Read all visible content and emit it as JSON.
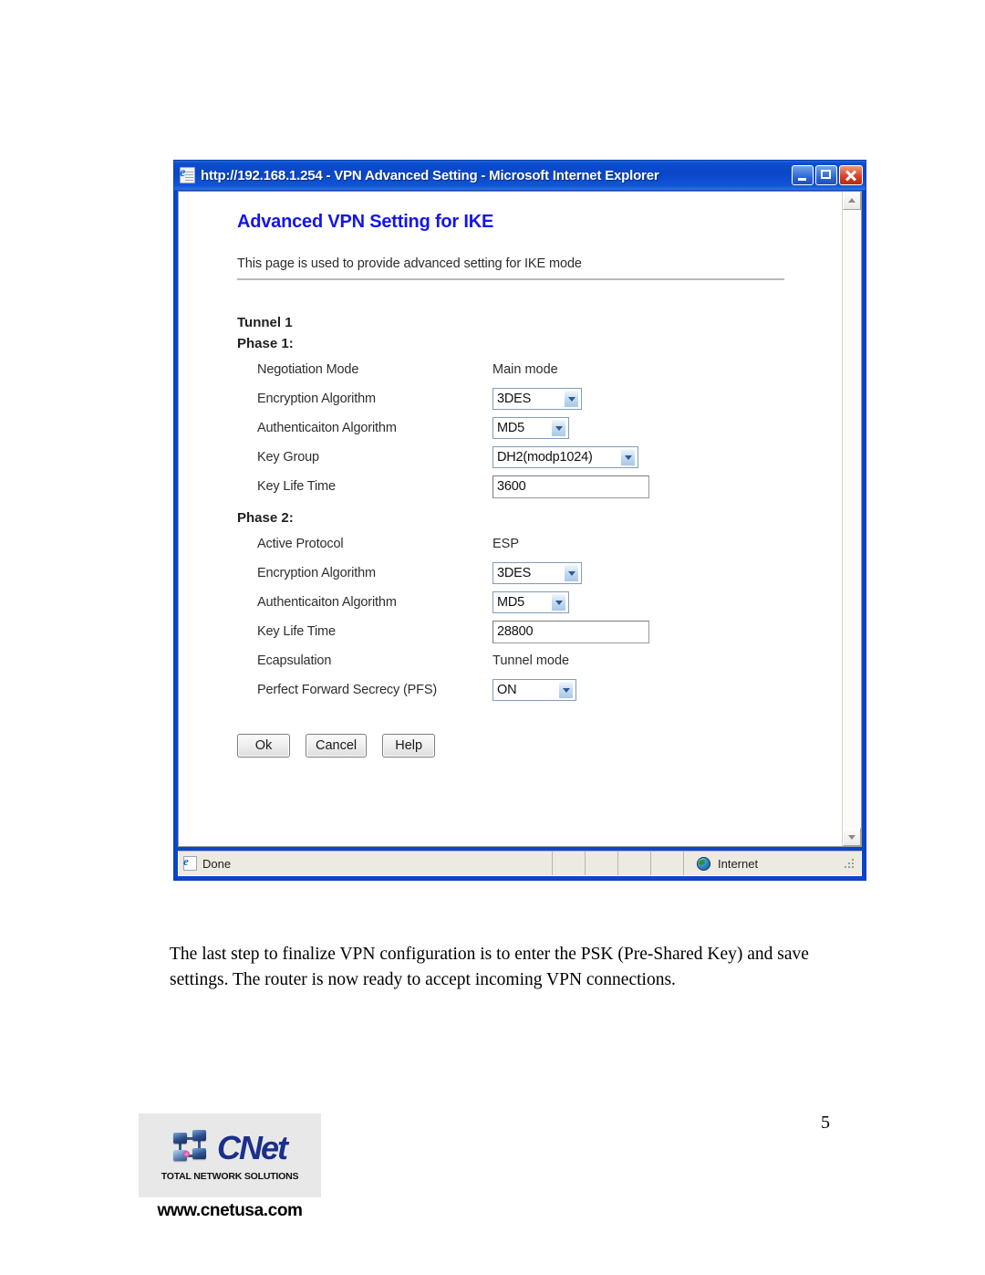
{
  "browser": {
    "title": "http://192.168.1.254 - VPN Advanced Setting - Microsoft Internet Explorer",
    "favicon": "ie-page-icon",
    "window_controls": {
      "minimize": "minimize-button",
      "maximize": "maximize-button",
      "close": "close-button"
    },
    "statusbar": {
      "status_text": "Done",
      "zone_text": "Internet"
    },
    "scrollbar": {
      "up_arrow": "scroll-up-arrow",
      "down_arrow": "scroll-down-arrow"
    }
  },
  "page": {
    "heading": "Advanced VPN Setting for IKE",
    "description": "This page is used to provide advanced setting for IKE mode",
    "tunnel_label": "Tunnel 1",
    "phase1": {
      "title": "Phase 1:",
      "rows": [
        {
          "label": "Negotiation Mode",
          "type": "static",
          "value": "Main mode"
        },
        {
          "label": "Encryption Algorithm",
          "type": "select",
          "value": "3DES"
        },
        {
          "label": "Authenticaiton Algorithm",
          "type": "select",
          "value": "MD5"
        },
        {
          "label": "Key Group",
          "type": "select",
          "value": "DH2(modp1024)"
        },
        {
          "label": "Key Life Time",
          "type": "input",
          "value": "3600"
        }
      ]
    },
    "phase2": {
      "title": "Phase 2:",
      "rows": [
        {
          "label": "Active Protocol",
          "type": "static",
          "value": "ESP"
        },
        {
          "label": "Encryption Algorithm",
          "type": "select",
          "value": "3DES"
        },
        {
          "label": "Authenticaiton Algorithm",
          "type": "select",
          "value": "MD5"
        },
        {
          "label": "Key Life Time",
          "type": "input",
          "value": "28800"
        },
        {
          "label": "Ecapsulation",
          "type": "static",
          "value": "Tunnel mode"
        },
        {
          "label": "Perfect Forward Secrecy (PFS)",
          "type": "select",
          "value": "ON"
        }
      ]
    },
    "buttons": {
      "ok": "Ok",
      "cancel": "Cancel",
      "help": "Help"
    }
  },
  "document": {
    "paragraph": "The last step to finalize VPN configuration is to enter the PSK (Pre-Shared Key) and save settings.  The router is now ready to accept incoming VPN connections.",
    "page_number": "5"
  },
  "footer": {
    "logo_word": "CNet",
    "logo_tagline": "TOTAL NETWORK SOLUTIONS",
    "url": "www.cnetusa.com"
  },
  "colors": {
    "title_bar_blue": "#0A46C8",
    "heading_blue": "#1414EE",
    "close_red": "#D8442A",
    "logo_navy": "#1B2F8C"
  }
}
